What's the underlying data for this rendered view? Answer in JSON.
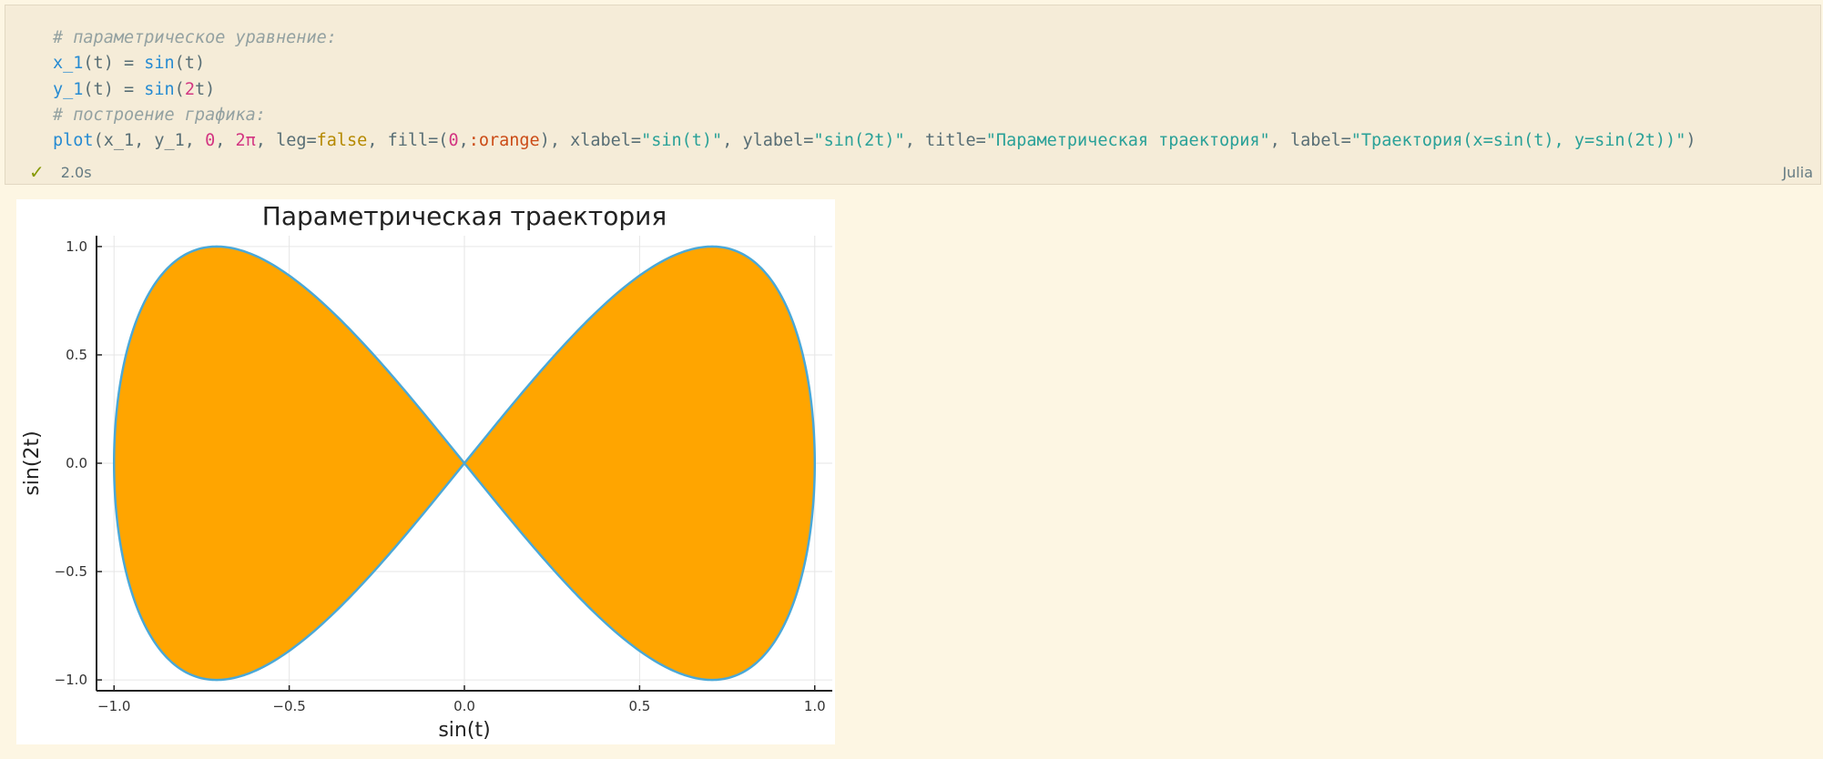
{
  "cell": {
    "code_lines": [
      [
        {
          "t": "# параметрическое уравнение:",
          "c": "c-comment"
        }
      ],
      [
        {
          "t": "x_1",
          "c": "c-fn"
        },
        {
          "t": "(t) = ",
          "c": ""
        },
        {
          "t": "sin",
          "c": "c-fn"
        },
        {
          "t": "(t)",
          "c": ""
        }
      ],
      [
        {
          "t": "y_1",
          "c": "c-fn"
        },
        {
          "t": "(t) = ",
          "c": ""
        },
        {
          "t": "sin",
          "c": "c-fn"
        },
        {
          "t": "(",
          "c": ""
        },
        {
          "t": "2",
          "c": "c-num"
        },
        {
          "t": "t)",
          "c": ""
        }
      ],
      [
        {
          "t": "# построение графика:",
          "c": "c-comment"
        }
      ],
      [
        {
          "t": "plot",
          "c": "c-fn"
        },
        {
          "t": "(x_1, y_1, ",
          "c": ""
        },
        {
          "t": "0",
          "c": "c-num"
        },
        {
          "t": ", ",
          "c": ""
        },
        {
          "t": "2π",
          "c": "c-num"
        },
        {
          "t": ", leg=",
          "c": ""
        },
        {
          "t": "false",
          "c": "c-bool"
        },
        {
          "t": ", fill=(",
          "c": ""
        },
        {
          "t": "0",
          "c": "c-num"
        },
        {
          "t": ",",
          "c": ""
        },
        {
          "t": ":orange",
          "c": "c-sym"
        },
        {
          "t": "), xlabel=",
          "c": ""
        },
        {
          "t": "\"sin(t)\"",
          "c": "c-str"
        },
        {
          "t": ", ylabel=",
          "c": ""
        },
        {
          "t": "\"sin(2t)\"",
          "c": "c-str"
        },
        {
          "t": ", title=",
          "c": ""
        },
        {
          "t": "\"Параметрическая траектория\"",
          "c": "c-str"
        },
        {
          "t": ", label=",
          "c": ""
        },
        {
          "t": "\"Траектория(x=sin(t), y=sin(2t))\"",
          "c": "c-str"
        },
        {
          "t": ")",
          "c": ""
        }
      ]
    ],
    "status_time": "2.0s",
    "language": "Julia"
  },
  "chart_data": {
    "type": "area",
    "title": "Параметрическая траектория",
    "xlabel": "sin(t)",
    "ylabel": "sin(2t)",
    "xlim": [
      -1.05,
      1.05
    ],
    "ylim": [
      -1.05,
      1.05
    ],
    "x_ticks": [
      -1.0,
      -0.5,
      0.0,
      0.5,
      1.0
    ],
    "y_ticks": [
      -1.0,
      -0.5,
      0.0,
      0.5,
      1.0
    ],
    "x_tick_labels": [
      "−1.0",
      "−0.5",
      "0.0",
      "0.5",
      "1.0"
    ],
    "y_tick_labels": [
      "−1.0",
      "−0.5",
      "0.0",
      "0.5",
      "1.0"
    ],
    "curve": "x = sin(t), y = sin(2t), t ∈ [0, 2π]",
    "fill_color": "#ffa500",
    "line_color": "#4aa8d8",
    "grid": true,
    "legend": false
  }
}
